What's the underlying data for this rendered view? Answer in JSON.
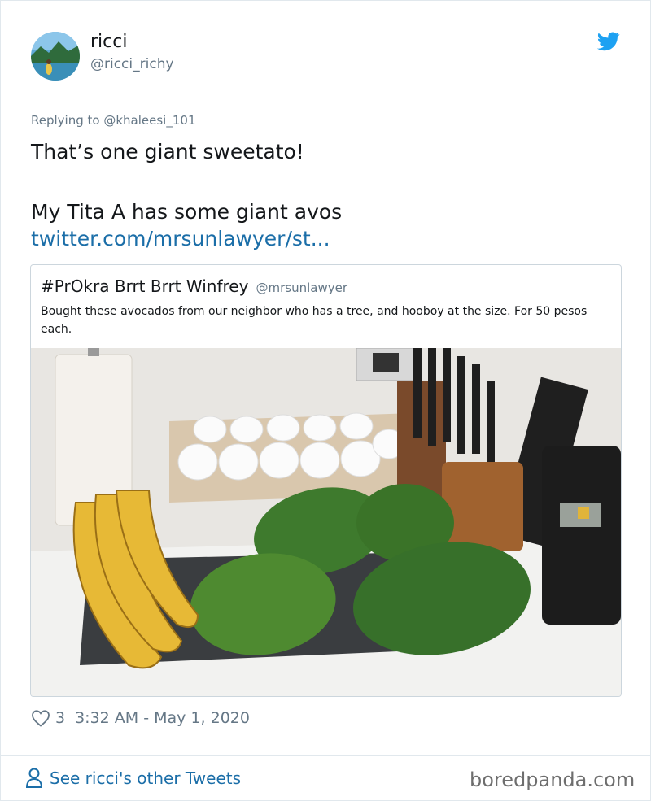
{
  "user": {
    "name": "ricci",
    "handle": "@ricci_richy"
  },
  "tweet": {
    "replying_prefix": "Replying to",
    "replying_handle": "@khaleesi_101",
    "line1": "That’s one giant sweetato!",
    "line2": "My Tita A has some giant avos",
    "link": "twitter.com/mrsunlawyer/st..."
  },
  "quoted": {
    "name": "#PrOkra Brrt Brrt Winfrey",
    "handle": "@mrsunlawyer",
    "text": "Bought these avocados from our neighbor who has a tree, and hooboy at the size. For 50 pesos each."
  },
  "meta": {
    "likes": "3",
    "timestamp": "3:32 AM - May 1, 2020"
  },
  "footer": {
    "see_more": "See ricci's other Tweets",
    "watermark": "boredpanda.com"
  },
  "icons": {
    "brand": "twitter-bird-icon",
    "like": "heart-icon",
    "profile": "person-icon"
  },
  "colors": {
    "link": "#1b6ea8",
    "twitter_blue": "#1da1f2",
    "secondary_text": "#657786",
    "border": "#ccd6dd"
  }
}
